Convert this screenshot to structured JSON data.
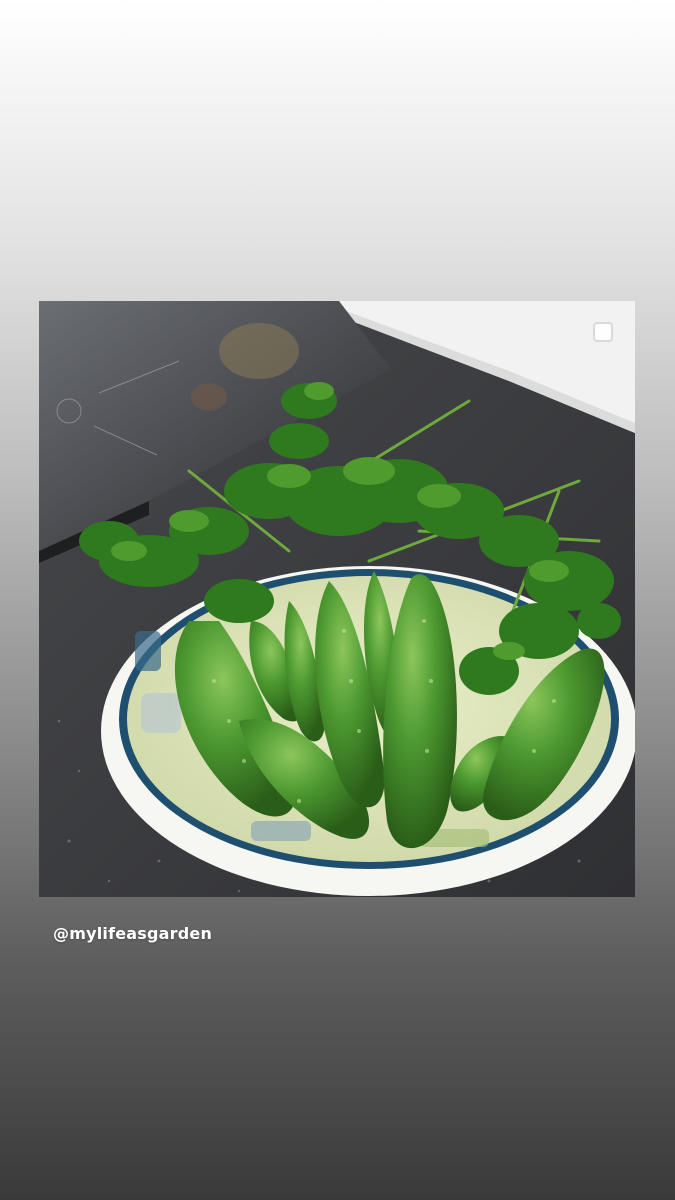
{
  "post": {
    "mention": "@mylifeasgarden",
    "photo_subject": "bowl-of-cucumbers-and-parsley"
  },
  "icons": {
    "select": "checkbox-icon"
  },
  "colors": {
    "counter": "#3c3c3e",
    "cucumber": "#3f8a2a",
    "parsley": "#2f7a1e",
    "bowl_rim": "#f4f4f2",
    "bowl_band": "#1f4f6f"
  }
}
